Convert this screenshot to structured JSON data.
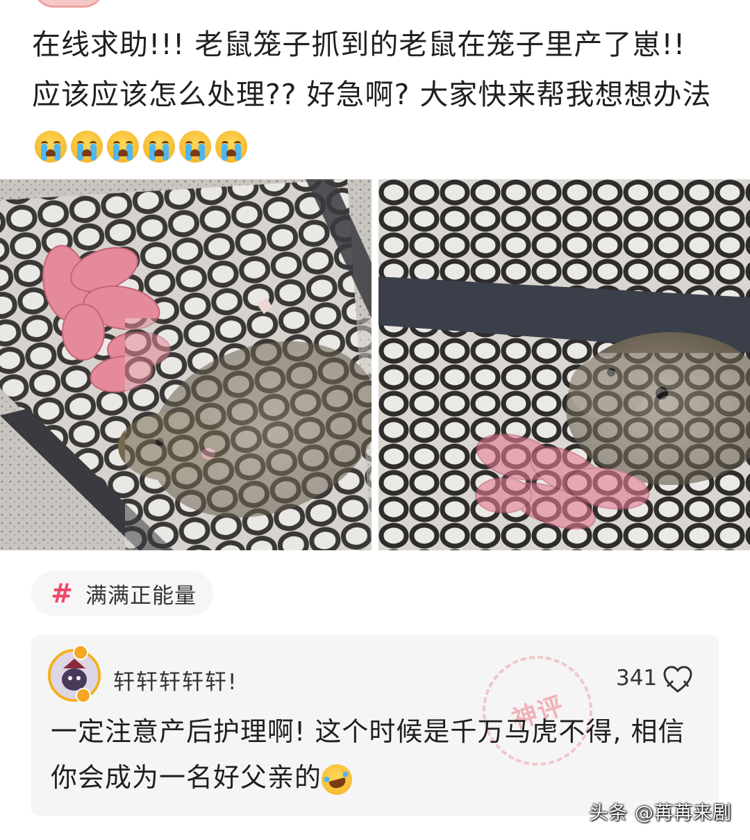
{
  "post": {
    "text": "在线求助!!! 老鼠笼子抓到的老鼠在笼子里产了崽!! 应该应该怎么处理?? 好急啊? 大家快来帮我想想办法",
    "emoji_count": 6,
    "emoji_name": "crying-face"
  },
  "images": [
    {
      "name": "rat-cage-photo-left",
      "subject": "rat with newborn pups in cage"
    },
    {
      "name": "rat-cage-photo-right",
      "subject": "rat with newborn pups in cage"
    }
  ],
  "hashtag": {
    "label": "满满正能量"
  },
  "comment": {
    "username": "轩轩轩轩轩!",
    "likes": "341",
    "stamp": "神评",
    "text": "一定注意产后护理啊! 这个时候是千万马虎不得, 相信你会成为一名好父亲的"
  },
  "watermark": "头条 @苒苒来剧",
  "colors": {
    "accent": "#f04a6a",
    "card_bg": "#f5f5f5",
    "avatar_ring": "#f1b11b"
  }
}
